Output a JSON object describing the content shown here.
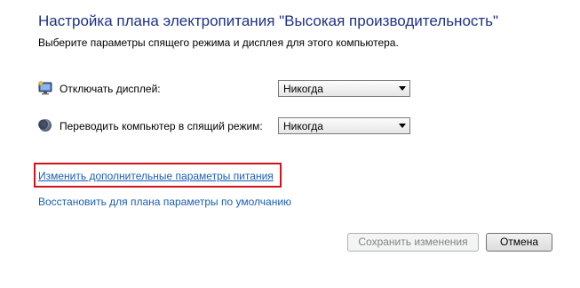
{
  "header": {
    "title": "Настройка плана электропитания \"Высокая производительность\"",
    "subtitle": "Выберите параметры спящего режима и дисплея для этого компьютера."
  },
  "settings": {
    "display_off": {
      "icon": "monitor-icon",
      "label": "Отключать дисплей:",
      "value": "Никогда"
    },
    "sleep": {
      "icon": "moon-icon",
      "label": "Переводить компьютер в спящий режим:",
      "value": "Никогда"
    }
  },
  "links": {
    "advanced": "Изменить дополнительные параметры питания",
    "restore": "Восстановить для плана параметры по умолчанию"
  },
  "buttons": {
    "save": "Сохранить изменения",
    "cancel": "Отмена"
  },
  "colors": {
    "title": "#1e3287",
    "link": "#1a5fb4",
    "highlight": "#d0141a"
  }
}
